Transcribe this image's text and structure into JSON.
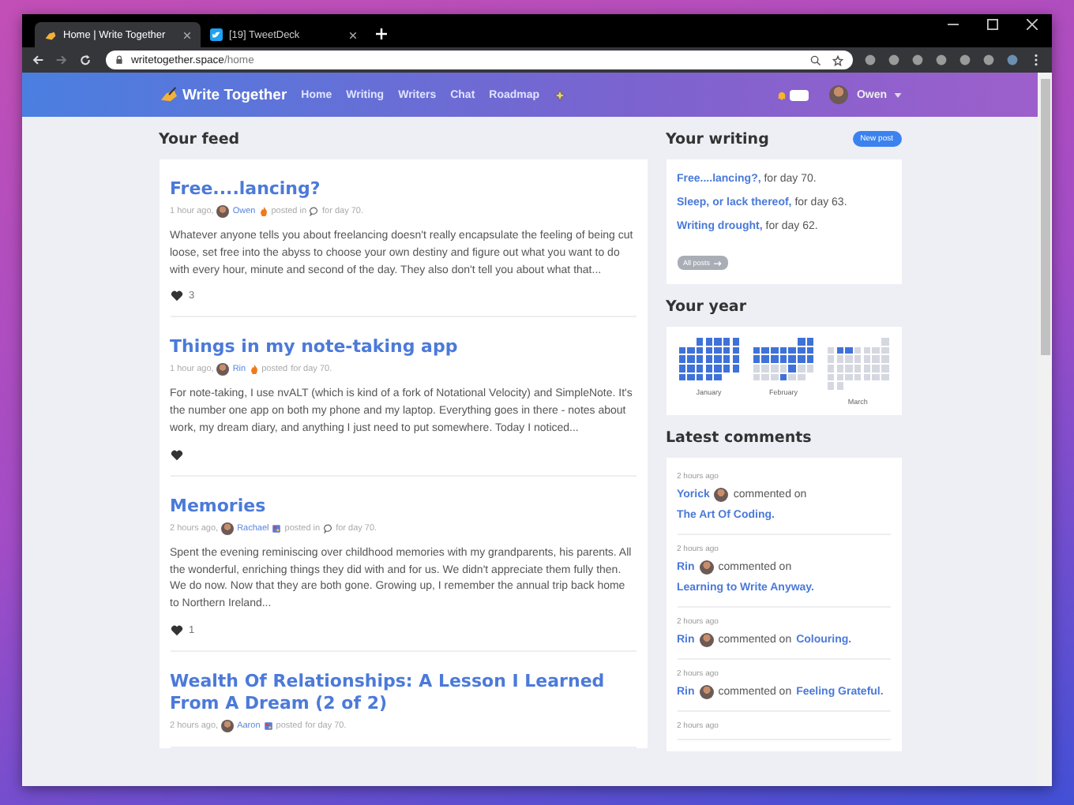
{
  "browser": {
    "tabs": [
      {
        "title": "Home | Write Together",
        "selected": true,
        "kind": "hand"
      },
      {
        "title": "[19] TweetDeck",
        "selected": false,
        "kind": "bird"
      }
    ],
    "address": {
      "host": "writetogether.space",
      "path": "/home"
    }
  },
  "nav": {
    "brand": "Write Together",
    "links": [
      "Home",
      "Writing",
      "Writers",
      "Chat",
      "Roadmap"
    ],
    "user": "Owen"
  },
  "feed": {
    "heading": "Your feed",
    "posts": [
      {
        "title": "Free....lancing?",
        "time": "1 hour ago,",
        "author": "Owen",
        "kind": "fire",
        "posted": "posted in",
        "bubble": true,
        "day": "for day 70.",
        "excerpt": "Whatever anyone tells you about freelancing doesn't really encapsulate the feeling of being cut loose, set free into the abyss to choose your own destiny and figure out what you want to do with every hour, minute and second of the day. They also don't tell you about what that...",
        "reacted": true,
        "likes": "3"
      },
      {
        "title": "Things in my note-taking app",
        "time": "1 hour ago,",
        "author": "Rin",
        "kind": "fire",
        "posted": "posted",
        "bubble": false,
        "day": "for day 70.",
        "excerpt": "For note-taking, I use nvALT (which is kind of a fork of Notational Velocity) and SimpleNote. It's the number one app on both my phone and my laptop. Everything goes in there - notes about work, my dream diary, and anything I just need to put somewhere. Today I noticed...",
        "reacted": true
      },
      {
        "title": "Memories",
        "time": "2 hours ago,",
        "author": "Rachael",
        "kind": "paint",
        "posted": "posted in",
        "bubble": true,
        "day": "for day 70.",
        "excerpt": "Spent the evening reminiscing over childhood memories with my grandparents, his parents. All the wonderful, enriching things they did with and for us. We didn't appreciate them fully then. We do now. Now that they are both gone. Growing up, I remember the annual trip back home to Northern Ireland...",
        "reacted": true,
        "likes": "1"
      },
      {
        "title": "Wealth Of Relationships: A Lesson I Learned From A Dream (2 of 2)",
        "time": "2 hours ago,",
        "author": "Aaron",
        "kind": "paint",
        "posted": "posted",
        "bubble": false,
        "day": "for day 70.",
        "reacted": false
      }
    ]
  },
  "writing": {
    "heading": "Your writing",
    "new_button": "New post",
    "items": [
      {
        "link": "Free....lancing?,",
        "rest": "for day 70."
      },
      {
        "link": "Sleep, or lack thereof,",
        "rest": "for day 63."
      },
      {
        "link": "Writing drought,",
        "rest": "for day 62."
      }
    ],
    "all_button": "All posts"
  },
  "year": {
    "heading": "Your year",
    "months": [
      {
        "name": "January",
        "days": [
          true,
          true,
          true,
          true,
          true,
          true,
          true,
          true,
          true,
          true,
          true,
          true,
          true,
          true,
          true,
          true,
          true,
          true,
          true,
          true,
          true,
          true,
          true,
          true,
          true,
          true,
          true,
          true,
          true,
          true,
          true
        ]
      },
      {
        "name": "February",
        "days": [
          true,
          true,
          true,
          true,
          true,
          true,
          true,
          true,
          true,
          true,
          true,
          true,
          true,
          true,
          true,
          true,
          false,
          false,
          false,
          false,
          true,
          false,
          false,
          false,
          false,
          false,
          true,
          false,
          false
        ]
      },
      {
        "name": "March",
        "days": [
          false,
          false,
          true,
          true,
          false,
          false,
          false,
          false,
          false,
          false,
          false,
          false,
          false,
          false,
          false,
          false,
          false,
          false,
          false,
          false,
          false,
          false,
          false,
          false,
          false,
          false,
          false,
          false,
          false,
          false,
          false
        ]
      }
    ]
  },
  "comments": {
    "heading": "Latest comments",
    "items": [
      {
        "time": "2 hours ago",
        "author": "Yorick",
        "action": "commented on",
        "target": "The Art Of Coding."
      },
      {
        "time": "2 hours ago",
        "author": "Rin",
        "action": "commented on",
        "target": "Learning to Write Anyway."
      },
      {
        "time": "2 hours ago",
        "author": "Rin",
        "action": "commented on",
        "target": "Colouring."
      },
      {
        "time": "2 hours ago",
        "author": "Rin",
        "action": "commented on",
        "target": "Feeling Grateful."
      },
      {
        "time": "2 hours ago"
      }
    ]
  }
}
